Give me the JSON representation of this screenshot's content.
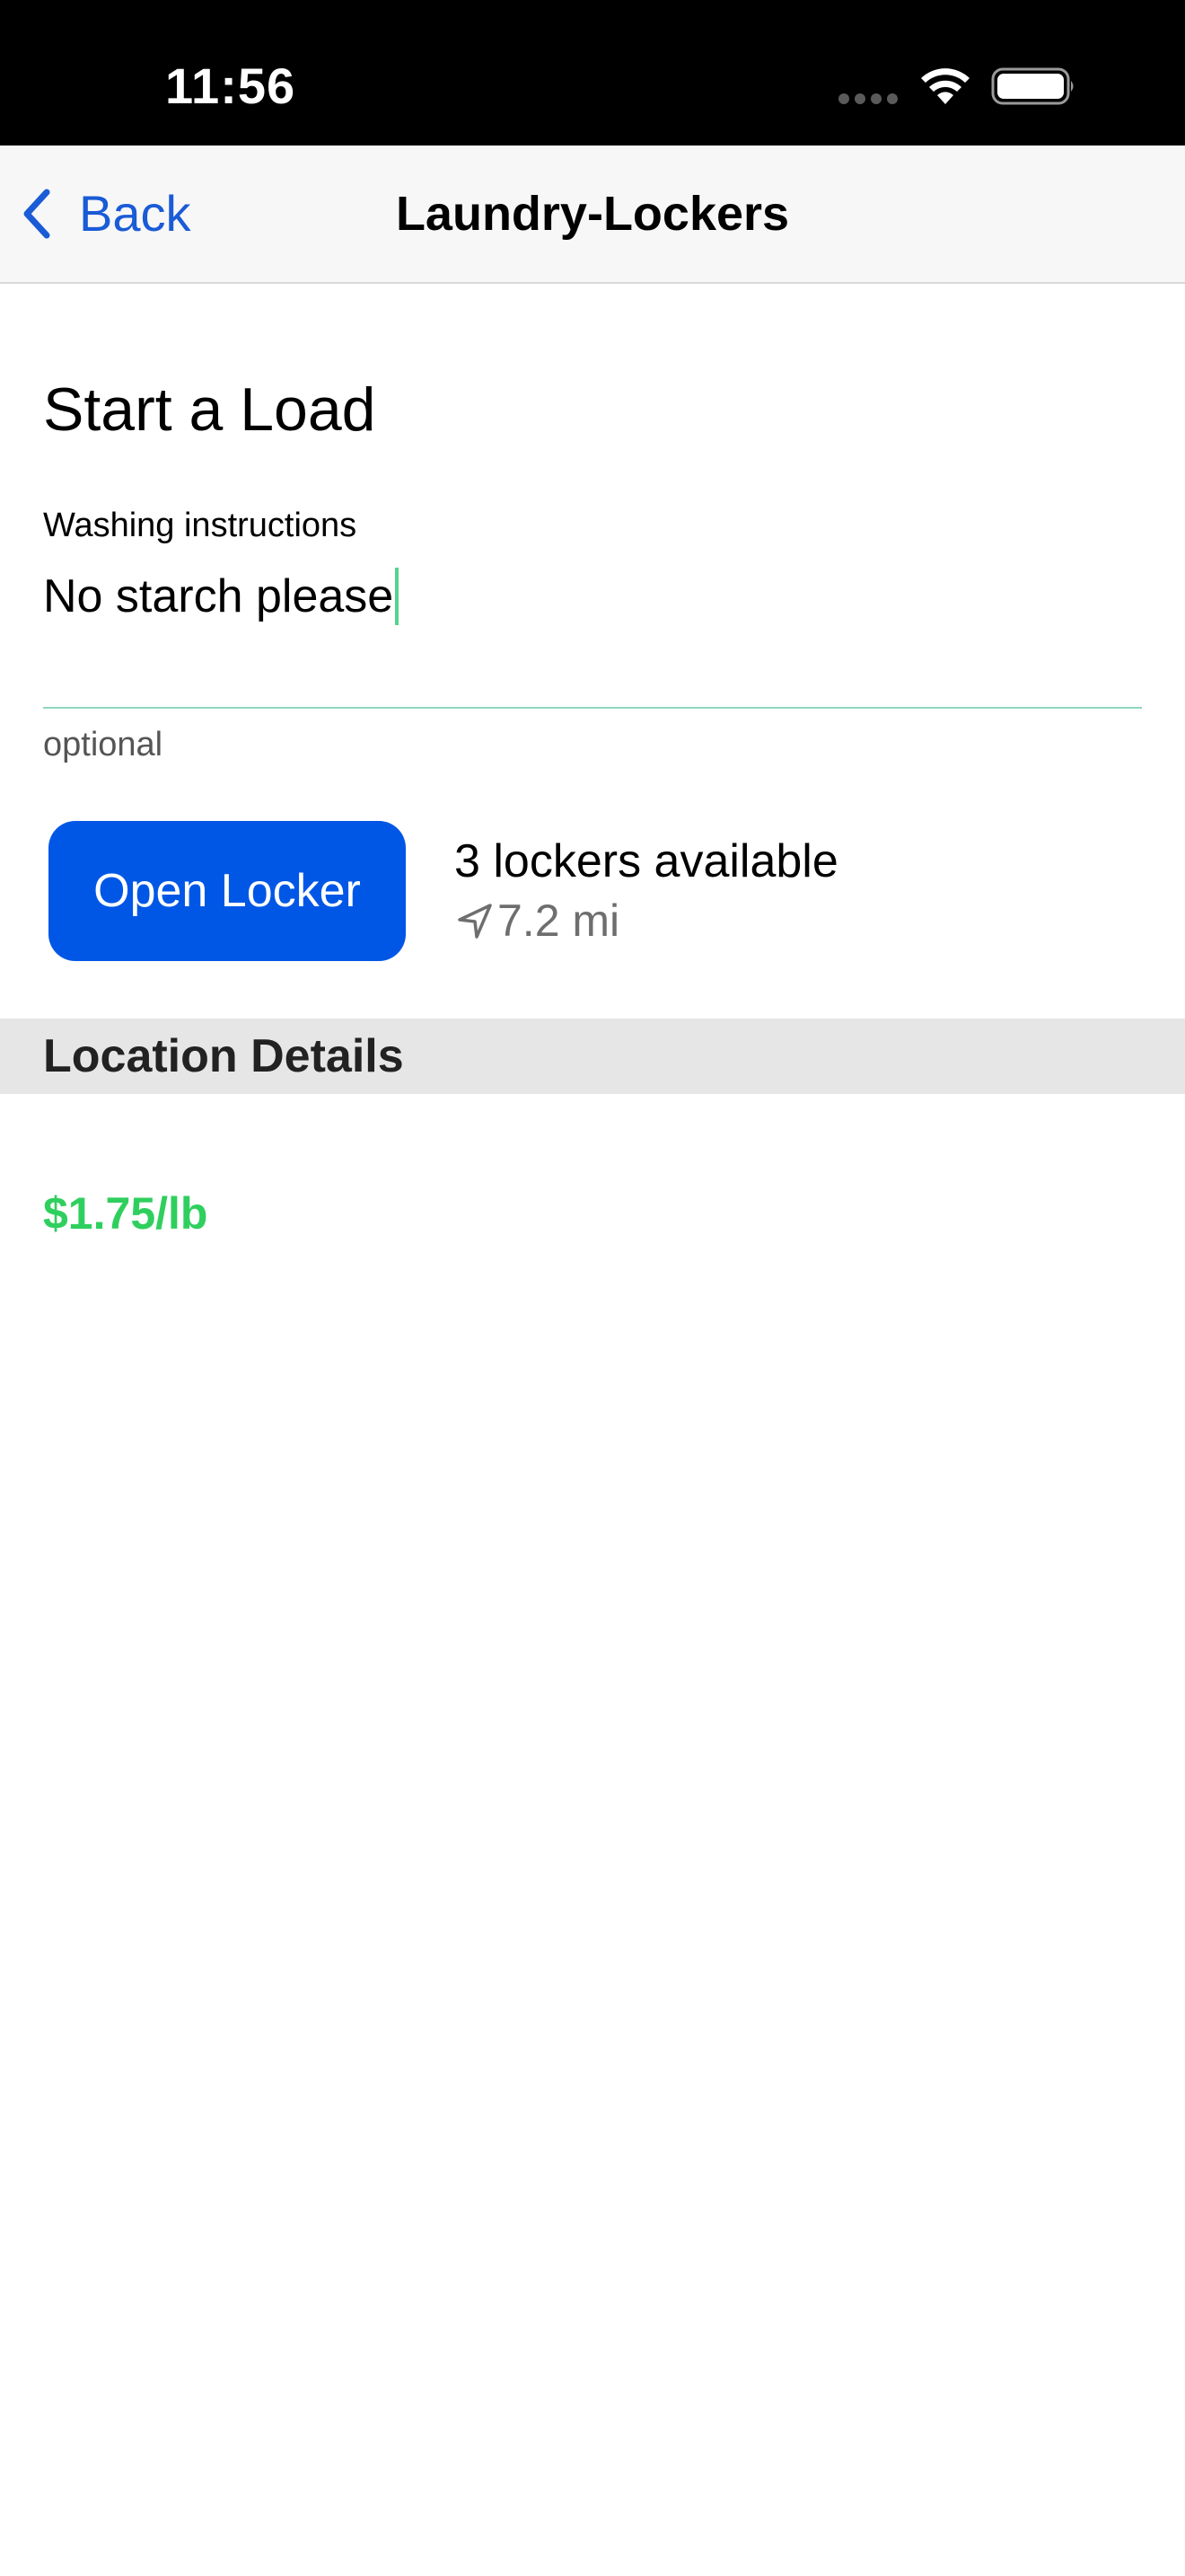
{
  "status_bar": {
    "time": "11:56"
  },
  "nav": {
    "back_label": "Back",
    "title": "Laundry-Lockers"
  },
  "form": {
    "section_title": "Start a Load",
    "instructions_label": "Washing instructions",
    "instructions_value": "No starch please",
    "instructions_hint": "optional"
  },
  "locker": {
    "button_label": "Open Locker",
    "availability": "3 lockers available",
    "distance": "7.2 mi"
  },
  "details": {
    "header": "Location Details",
    "price": "$1.75/lb"
  },
  "colors": {
    "accent_blue": "#0057e6",
    "back_blue": "#1a5bd6",
    "price_green": "#2fcf5e",
    "caret_green": "#54d48c"
  },
  "icons": [
    "chevron-left-icon",
    "location-arrow-icon",
    "wifi-icon",
    "battery-icon",
    "signal-dots-icon"
  ]
}
